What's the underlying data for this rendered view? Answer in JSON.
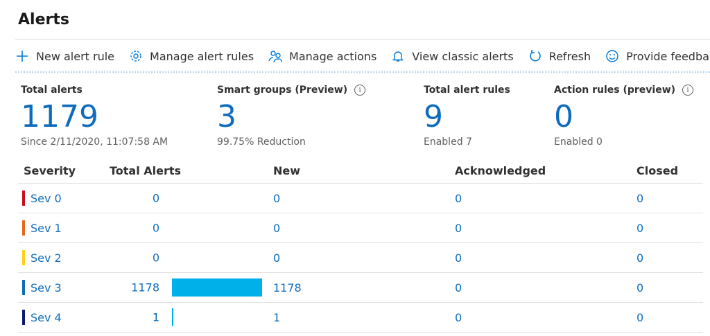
{
  "page": {
    "title": "Alerts"
  },
  "toolbar": {
    "items": [
      {
        "label": "New alert rule",
        "icon": "plus-icon"
      },
      {
        "label": "Manage alert rules",
        "icon": "gear-icon"
      },
      {
        "label": "Manage actions",
        "icon": "people-icon"
      },
      {
        "label": "View classic alerts",
        "icon": "bell-icon"
      },
      {
        "label": "Refresh",
        "icon": "refresh-icon"
      },
      {
        "label": "Provide feedback",
        "icon": "smiley-icon"
      }
    ]
  },
  "summary": {
    "total_alerts": {
      "label": "Total alerts",
      "value": "1179",
      "sub": "Since 2/11/2020, 11:07:58 AM"
    },
    "smart_groups": {
      "label": "Smart groups (Preview)",
      "value": "3",
      "sub": "99.75% Reduction"
    },
    "total_alert_rules": {
      "label": "Total alert rules",
      "value": "9",
      "sub": "Enabled 7"
    },
    "action_rules": {
      "label": "Action rules (preview)",
      "value": "0",
      "sub": "Enabled 0"
    }
  },
  "table": {
    "headers": {
      "severity": "Severity",
      "total": "Total Alerts",
      "new": "New",
      "acknowledged": "Acknowledged",
      "closed": "Closed"
    },
    "max_total": 1178,
    "rows": [
      {
        "severity": "Sev 0",
        "color": "#c50f1f",
        "total": "0",
        "new": "0",
        "acknowledged": "0",
        "closed": "0",
        "bar_value": 0
      },
      {
        "severity": "Sev 1",
        "color": "#e3681b",
        "total": "0",
        "new": "0",
        "acknowledged": "0",
        "closed": "0",
        "bar_value": 0
      },
      {
        "severity": "Sev 2",
        "color": "#fcd116",
        "total": "0",
        "new": "0",
        "acknowledged": "0",
        "closed": "0",
        "bar_value": 0
      },
      {
        "severity": "Sev 3",
        "color": "#0f6cbd",
        "total": "1178",
        "new": "1178",
        "acknowledged": "0",
        "closed": "0",
        "bar_value": 1178
      },
      {
        "severity": "Sev 4",
        "color": "#0b1a6b",
        "total": "1",
        "new": "1",
        "acknowledged": "0",
        "closed": "0",
        "bar_value": 1
      }
    ]
  }
}
